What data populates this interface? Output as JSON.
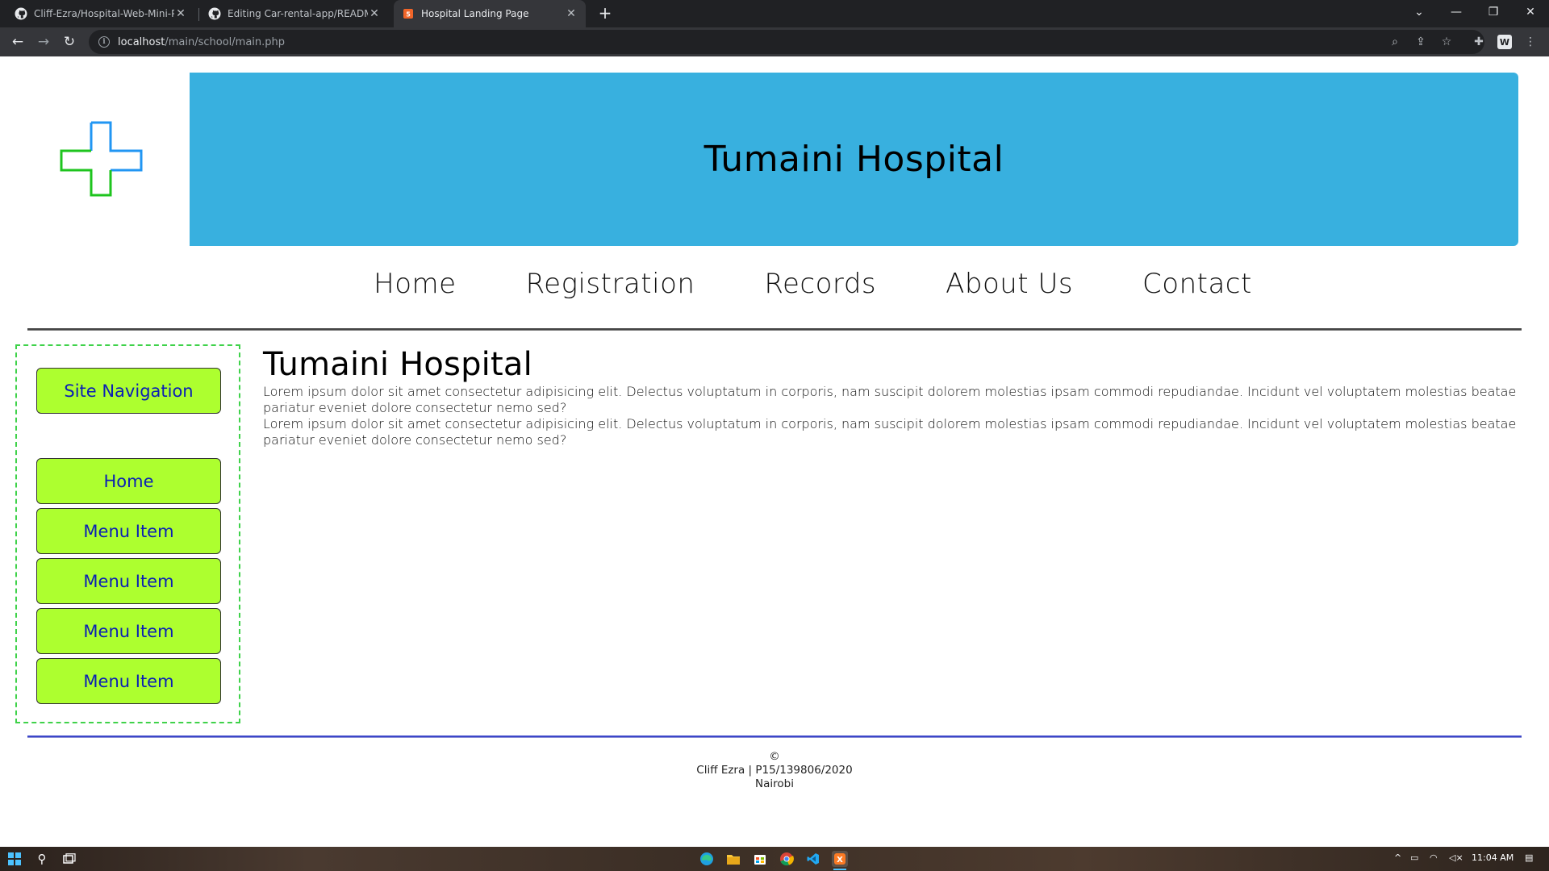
{
  "browser": {
    "tabs": [
      {
        "title": "Cliff-Ezra/Hospital-Web-Mini-Pro",
        "favicon": "github-icon"
      },
      {
        "title": "Editing Car-rental-app/README.m",
        "favicon": "github-icon"
      },
      {
        "title": "Hospital Landing Page",
        "favicon": "html5-icon"
      }
    ],
    "url_host": "localhost",
    "url_path": "/main/school/main.php"
  },
  "header": {
    "title": "Tumaini Hospital",
    "logo": "medical-cross-icon",
    "banner_color": "#38b0df"
  },
  "nav": {
    "items": [
      "Home",
      "Registration",
      "Records",
      "About Us",
      "Contact"
    ]
  },
  "sidebar": {
    "heading": "Site Navigation",
    "items": [
      "Home",
      "Menu Item",
      "Menu Item",
      "Menu Item",
      "Menu Item"
    ],
    "button_color": "#adff2f",
    "text_color": "#0b1fb5"
  },
  "main": {
    "title": "Tumaini Hospital",
    "paragraphs": [
      "Lorem ipsum dolor sit amet consectetur adipisicing elit. Delectus voluptatum in corporis, nam suscipit dolorem molestias ipsam commodi repudiandae. Incidunt vel voluptatem molestias beatae pariatur eveniet dolore consectetur nemo sed?",
      "Lorem ipsum dolor sit amet consectetur adipisicing elit. Delectus voluptatum in corporis, nam suscipit dolorem molestias ipsam commodi repudiandae. Incidunt vel voluptatem molestias beatae pariatur eveniet dolore consectetur nemo sed?"
    ]
  },
  "footer": {
    "copyright": "©",
    "author": "Cliff Ezra | P15/139806/2020",
    "city": "Nairobi"
  },
  "taskbar": {
    "time": "11:04 AM"
  }
}
